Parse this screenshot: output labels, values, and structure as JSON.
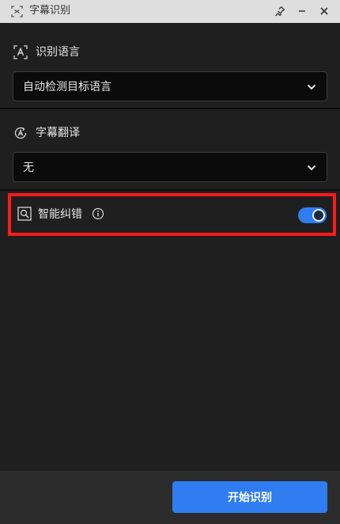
{
  "window": {
    "title": "字幕识别",
    "icons": {
      "app": "subtitle-scan-icon",
      "pin": "pin-icon",
      "minimize": "minimize-icon",
      "close": "close-icon"
    }
  },
  "recognition_language": {
    "label": "识别语言",
    "icon": "language-a-icon",
    "selected": "自动检测目标语言"
  },
  "subtitle_translation": {
    "label": "字幕翻译",
    "icon": "translate-icon",
    "selected": "无"
  },
  "smart_correction": {
    "label": "智能纠错",
    "icon": "magnify-check-icon",
    "info_icon": "info-icon",
    "enabled": true
  },
  "footer": {
    "start_label": "开始识别"
  },
  "colors": {
    "accent": "#2f7df1",
    "highlight_border": "#ff1a1a",
    "background": "#1f1f1f",
    "titlebar": "#dedede"
  }
}
